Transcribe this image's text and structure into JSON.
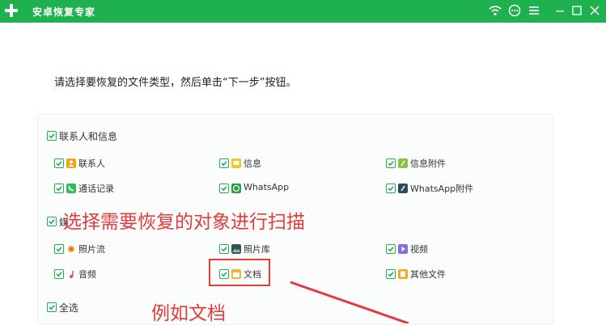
{
  "window": {
    "title": "安卓恢复专家"
  },
  "instruction": "请选择要恢复的文件类型，然后单击“下一步”按钮。",
  "groups": [
    {
      "label": "联系人和信息",
      "items": [
        {
          "label": "联系人",
          "icon": "contact-icon"
        },
        {
          "label": "信息",
          "icon": "message-icon"
        },
        {
          "label": "信息附件",
          "icon": "attachment-icon"
        },
        {
          "label": "通话记录",
          "icon": "phone-icon"
        },
        {
          "label": "WhatsApp",
          "icon": "whatsapp-icon"
        },
        {
          "label": "WhatsApp附件",
          "icon": "whatsapp-attachment-icon"
        }
      ]
    },
    {
      "label": "媒",
      "items": [
        {
          "label": "照片流",
          "icon": "photo-stream-icon"
        },
        {
          "label": "照片库",
          "icon": "photo-library-icon"
        },
        {
          "label": "视频",
          "icon": "video-icon"
        },
        {
          "label": "音频",
          "icon": "audio-icon"
        },
        {
          "label": "文档",
          "icon": "document-icon"
        },
        {
          "label": "其他文件",
          "icon": "other-files-icon"
        }
      ]
    }
  ],
  "select_all": "全选",
  "annotations": {
    "main": "选择需要恢复的对象进行扫描",
    "example": "例如文档"
  },
  "colors": {
    "accent": "#1fb14f",
    "annotation": "#e33b3b"
  }
}
